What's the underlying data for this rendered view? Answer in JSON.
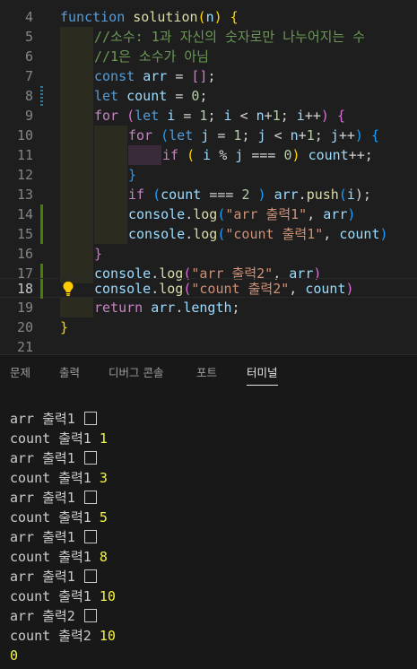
{
  "editor": {
    "line_numbers": [
      "4",
      "5",
      "6",
      "7",
      "8",
      "9",
      "10",
      "11",
      "12",
      "13",
      "14",
      "15",
      "16",
      "17",
      "18",
      "19",
      "20",
      "21"
    ],
    "active_line": "18",
    "tokens": {
      "l4": [
        "function",
        "solution",
        "(",
        "n",
        ")",
        "{"
      ],
      "l5": [
        "//소수: 1과 자신의 숫자로만 나누어지는 수"
      ],
      "l6": [
        "//1은 소수가 아님"
      ],
      "l7": [
        "const",
        "arr",
        "=",
        "[]",
        ";"
      ],
      "l8": [
        "let",
        "count",
        "=",
        "0",
        ";"
      ],
      "l9": [
        "for",
        "(",
        "let",
        "i",
        "=",
        "1",
        ";",
        "i",
        "<",
        "n",
        "+",
        "1",
        ";",
        "i",
        "++",
        ")",
        "{"
      ],
      "l10": [
        "for",
        "(",
        "let",
        "j",
        "=",
        "1",
        ";",
        "j",
        "<",
        "n",
        "+",
        "1",
        ";",
        "j",
        "++",
        ")",
        "{"
      ],
      "l11": [
        "if",
        "(",
        "i",
        "%",
        "j",
        "===",
        "0",
        ")",
        "count",
        "++;"
      ],
      "l12": [
        "}"
      ],
      "l13": [
        "if",
        "(",
        "count",
        "===",
        "2",
        ")",
        "arr",
        ".",
        "push",
        "(",
        "i",
        ");"
      ],
      "l14": [
        "console",
        ".",
        "log",
        "(",
        "\"arr 출력1\"",
        ",",
        "arr",
        ")"
      ],
      "l15": [
        "console",
        ".",
        "log",
        "(",
        "\"count 출력1\"",
        ",",
        "count",
        ")"
      ],
      "l16": [
        "}"
      ],
      "l17": [
        "console",
        ".",
        "log",
        "(",
        "\"arr 출력2\"",
        ",",
        "arr",
        ")"
      ],
      "l18": [
        "console",
        ".",
        "log",
        "(",
        "\"count 출력2\"",
        ",",
        "count",
        ")"
      ],
      "l19": [
        "return",
        "arr",
        ".",
        "length",
        ";"
      ],
      "l20": [
        "}"
      ]
    }
  },
  "panel": {
    "tabs": [
      "문제",
      "출력",
      "디버그 콘솔",
      "포트",
      "터미널"
    ],
    "active_tab": "터미널"
  },
  "terminal": {
    "lines": [
      {
        "label": "arr 출력1",
        "value": ""
      },
      {
        "label": "count 출력1",
        "value": "1"
      },
      {
        "label": "arr 출력1",
        "value": ""
      },
      {
        "label": "count 출력1",
        "value": "3"
      },
      {
        "label": "arr 출력1",
        "value": ""
      },
      {
        "label": "count 출력1",
        "value": "5"
      },
      {
        "label": "arr 출력1",
        "value": ""
      },
      {
        "label": "count 출력1",
        "value": "8"
      },
      {
        "label": "arr 출력1",
        "value": ""
      },
      {
        "label": "count 출력1",
        "value": "10"
      },
      {
        "label": "arr 출력2",
        "value": ""
      },
      {
        "label": "count 출력2",
        "value": "10"
      }
    ],
    "result": "0"
  },
  "colors": {
    "keyword": "#569cd6",
    "control": "#c586c0",
    "function": "#dcdcaa",
    "variable": "#9cdcfe",
    "number": "#b5cea8",
    "string": "#ce9178",
    "comment": "#6a9955",
    "terminal_number": "#f5f543"
  }
}
